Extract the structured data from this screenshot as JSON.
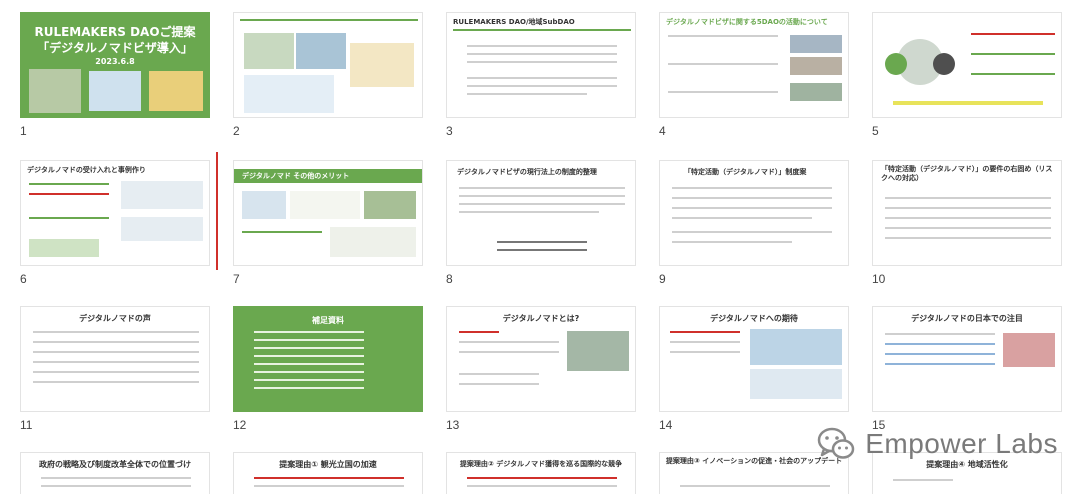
{
  "slides": [
    {
      "n": "1",
      "title": "RULEMAKERS DAOご提案\n「デジタルノマドビザ導入」",
      "sub": "2023.6.8",
      "theme": "green-cover"
    },
    {
      "n": "2",
      "title": "",
      "theme": "collage"
    },
    {
      "n": "3",
      "title": "RULEMAKERS DAO/地域SubDAO",
      "theme": "text"
    },
    {
      "n": "4",
      "title": "デジタルノマドビザに関する5DAOの活動について",
      "theme": "photos"
    },
    {
      "n": "5",
      "title": "",
      "theme": "diagram"
    },
    {
      "n": "6",
      "title": "デジタルノマドの受け入れと事例作り",
      "theme": "text-green"
    },
    {
      "n": "7",
      "title": "デジタルノマド その他のメリット",
      "theme": "green-header"
    },
    {
      "n": "8",
      "title": "デジタルノマドビザの現行法上の制度的整理",
      "theme": "text"
    },
    {
      "n": "9",
      "title": "「特定活動（デジタルノマド）」制度案",
      "theme": "text"
    },
    {
      "n": "10",
      "title": "「特定活動（デジタルノマド）」の要件の右固め（リスクへの対応）",
      "theme": "text"
    },
    {
      "n": "11",
      "title": "デジタルノマドの声",
      "theme": "text"
    },
    {
      "n": "12",
      "title": "補足資料",
      "theme": "green-list"
    },
    {
      "n": "13",
      "title": "デジタルノマドとは?",
      "theme": "text-img"
    },
    {
      "n": "14",
      "title": "デジタルノマドへの期待",
      "theme": "map"
    },
    {
      "n": "15",
      "title": "デジタルノマドの日本での注目",
      "theme": "text-img"
    },
    {
      "n": "",
      "title": "政府の戦略及び制度改革全体での位置づけ",
      "theme": "partial"
    },
    {
      "n": "",
      "title": "提案理由① 観光立国の加速",
      "theme": "partial"
    },
    {
      "n": "",
      "title": "提案理由② デジタルノマド獲得を巡る国際的な競争",
      "theme": "partial"
    },
    {
      "n": "",
      "title": "提案理由③ イノベーションの促進・社会のアップデート",
      "theme": "partial"
    },
    {
      "n": "",
      "title": "提案理由④ 地域活性化",
      "theme": "partial"
    }
  ],
  "watermark": {
    "text": "Empower Labs",
    "icon": "wechat-icon"
  },
  "selected_after": "6",
  "colors": {
    "accent": "#6aa84f",
    "selection": "#d0302b"
  }
}
